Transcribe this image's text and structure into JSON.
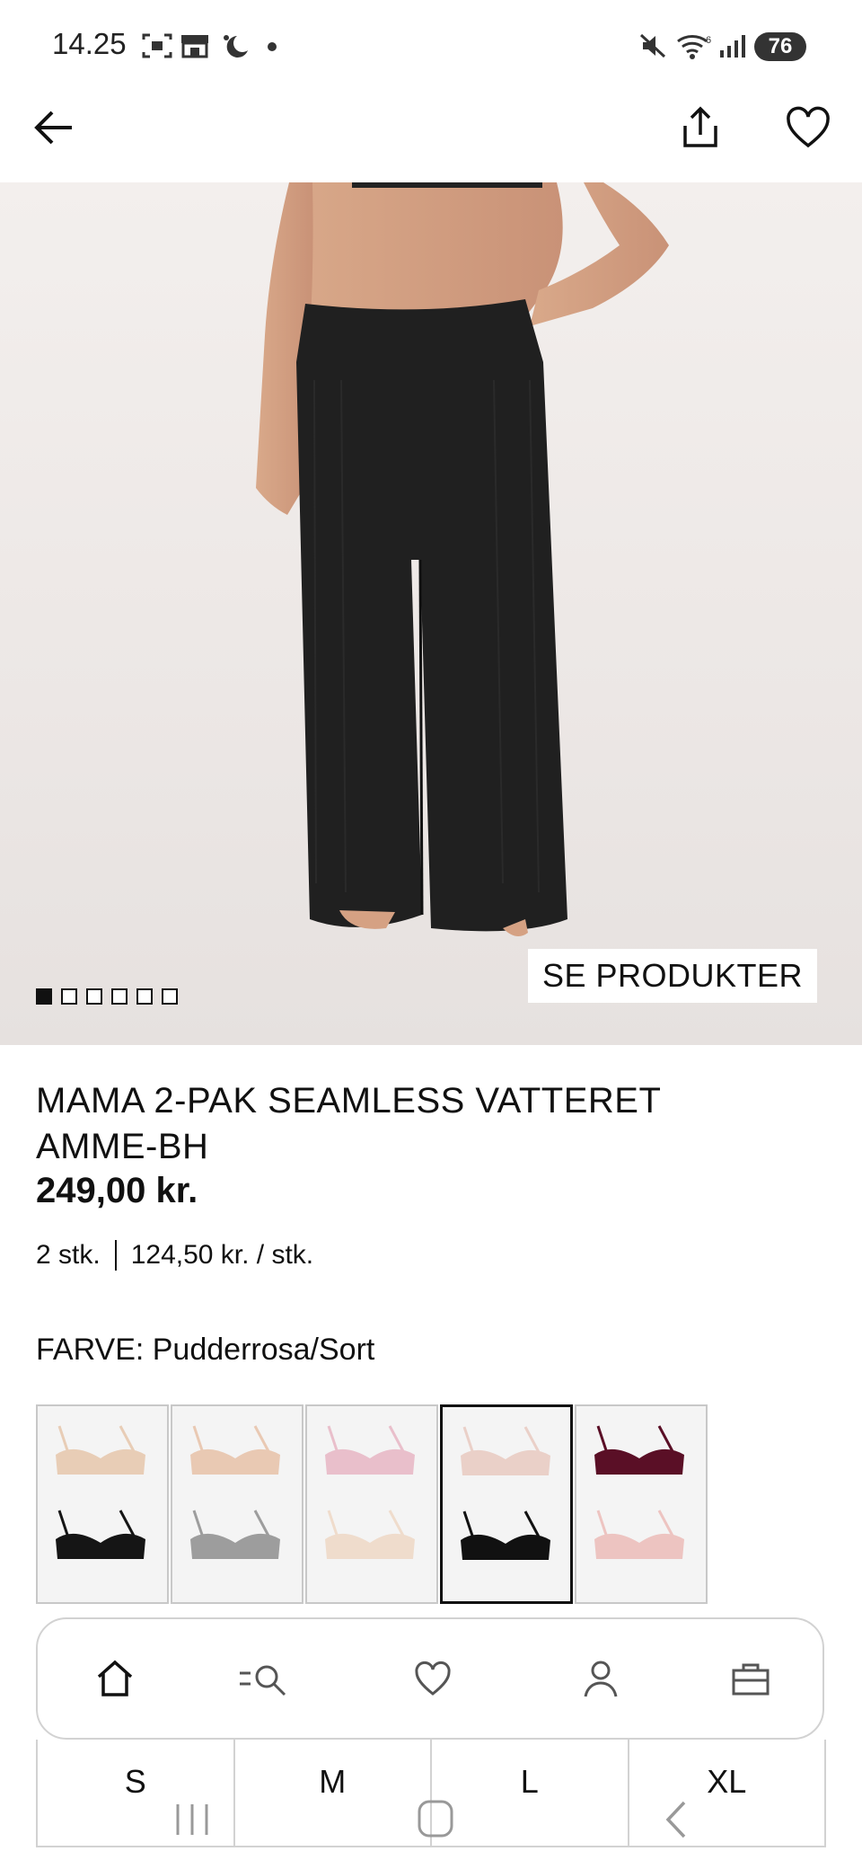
{
  "status_bar": {
    "time": "14.25",
    "battery": "76"
  },
  "hero": {
    "cta_label": "SE PRODUKTER",
    "image_count": 6,
    "active_index": 0
  },
  "product": {
    "title": "MAMA 2-PAK SEAMLESS VATTERET AMME-BH",
    "price": "249,00 kr.",
    "quantity": "2 stk.",
    "unit_price": "124,50 kr. / stk.",
    "color_label": "FARVE: Pudderrosa/Sort"
  },
  "swatches": [
    {
      "top_color": "#e8cdb6",
      "bottom_color": "#151515",
      "selected": false
    },
    {
      "top_color": "#e9c9b3",
      "bottom_color": "#9d9d9d",
      "selected": false
    },
    {
      "top_color": "#e9bfcb",
      "bottom_color": "#efdccc",
      "selected": false
    },
    {
      "top_color": "#ead0c8",
      "bottom_color": "#111111",
      "selected": true
    },
    {
      "top_color": "#5a0f26",
      "bottom_color": "#edc4c1",
      "selected": false
    }
  ],
  "bottom_nav": [
    {
      "icon": "home-icon"
    },
    {
      "icon": "search-filter-icon"
    },
    {
      "icon": "heart-icon"
    },
    {
      "icon": "profile-icon"
    },
    {
      "icon": "shopping-bag-icon"
    }
  ],
  "sizes": [
    "S",
    "M",
    "L",
    "XL"
  ]
}
